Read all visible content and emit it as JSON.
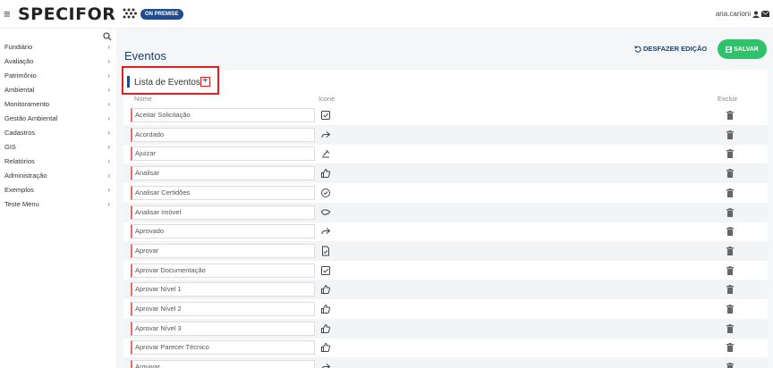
{
  "header": {
    "logo_text": "SPECIFOR",
    "badge": "ON PREMISE",
    "user": "ana.carioni"
  },
  "sidebar": {
    "items": [
      {
        "label": "Fundiário"
      },
      {
        "label": "Avaliação"
      },
      {
        "label": "Patrimônio"
      },
      {
        "label": "Ambiental"
      },
      {
        "label": "Monitoramento"
      },
      {
        "label": "Gestão Ambiental"
      },
      {
        "label": "Cadastros"
      },
      {
        "label": "GIS"
      },
      {
        "label": "Relatórios"
      },
      {
        "label": "Administração"
      },
      {
        "label": "Exemplos"
      },
      {
        "label": "Teste Menu"
      }
    ]
  },
  "main": {
    "title": "Eventos",
    "undo_label": "DESFAZER EDIÇÃO",
    "save_label": "SALVAR",
    "section_title": "Lista de Eventos",
    "columns": {
      "name": "Nome",
      "icon": "Icone",
      "delete": "Excluir"
    },
    "rows": [
      {
        "name": "Aceitar Solicitação",
        "icon": "check-square-icon"
      },
      {
        "name": "Acordado",
        "icon": "share-arrow-icon"
      },
      {
        "name": "Ajuizar",
        "icon": "gavel-icon"
      },
      {
        "name": "Analisar",
        "icon": "thumbs-up-icon"
      },
      {
        "name": "Analisar Certidões",
        "icon": "check-circle-icon"
      },
      {
        "name": "Analisar Imóvel",
        "icon": "handshake-icon"
      },
      {
        "name": "Aprovado",
        "icon": "share-arrow-icon"
      },
      {
        "name": "Aprovar",
        "icon": "document-icon"
      },
      {
        "name": "Aprovar Documentação",
        "icon": "check-square-icon"
      },
      {
        "name": "Aprovar Nível 1",
        "icon": "thumbs-up-icon"
      },
      {
        "name": "Aprovar Nível 2",
        "icon": "thumbs-up-icon"
      },
      {
        "name": "Aprovar Nível 3",
        "icon": "thumbs-up-icon"
      },
      {
        "name": "Aprovar Parecer Técnico",
        "icon": "thumbs-up-icon"
      },
      {
        "name": "Arquivar",
        "icon": "share-arrow-icon"
      }
    ]
  },
  "colors": {
    "brand_blue": "#1f4b8f",
    "save_green": "#2ec26b",
    "highlight_red": "#e02020"
  }
}
